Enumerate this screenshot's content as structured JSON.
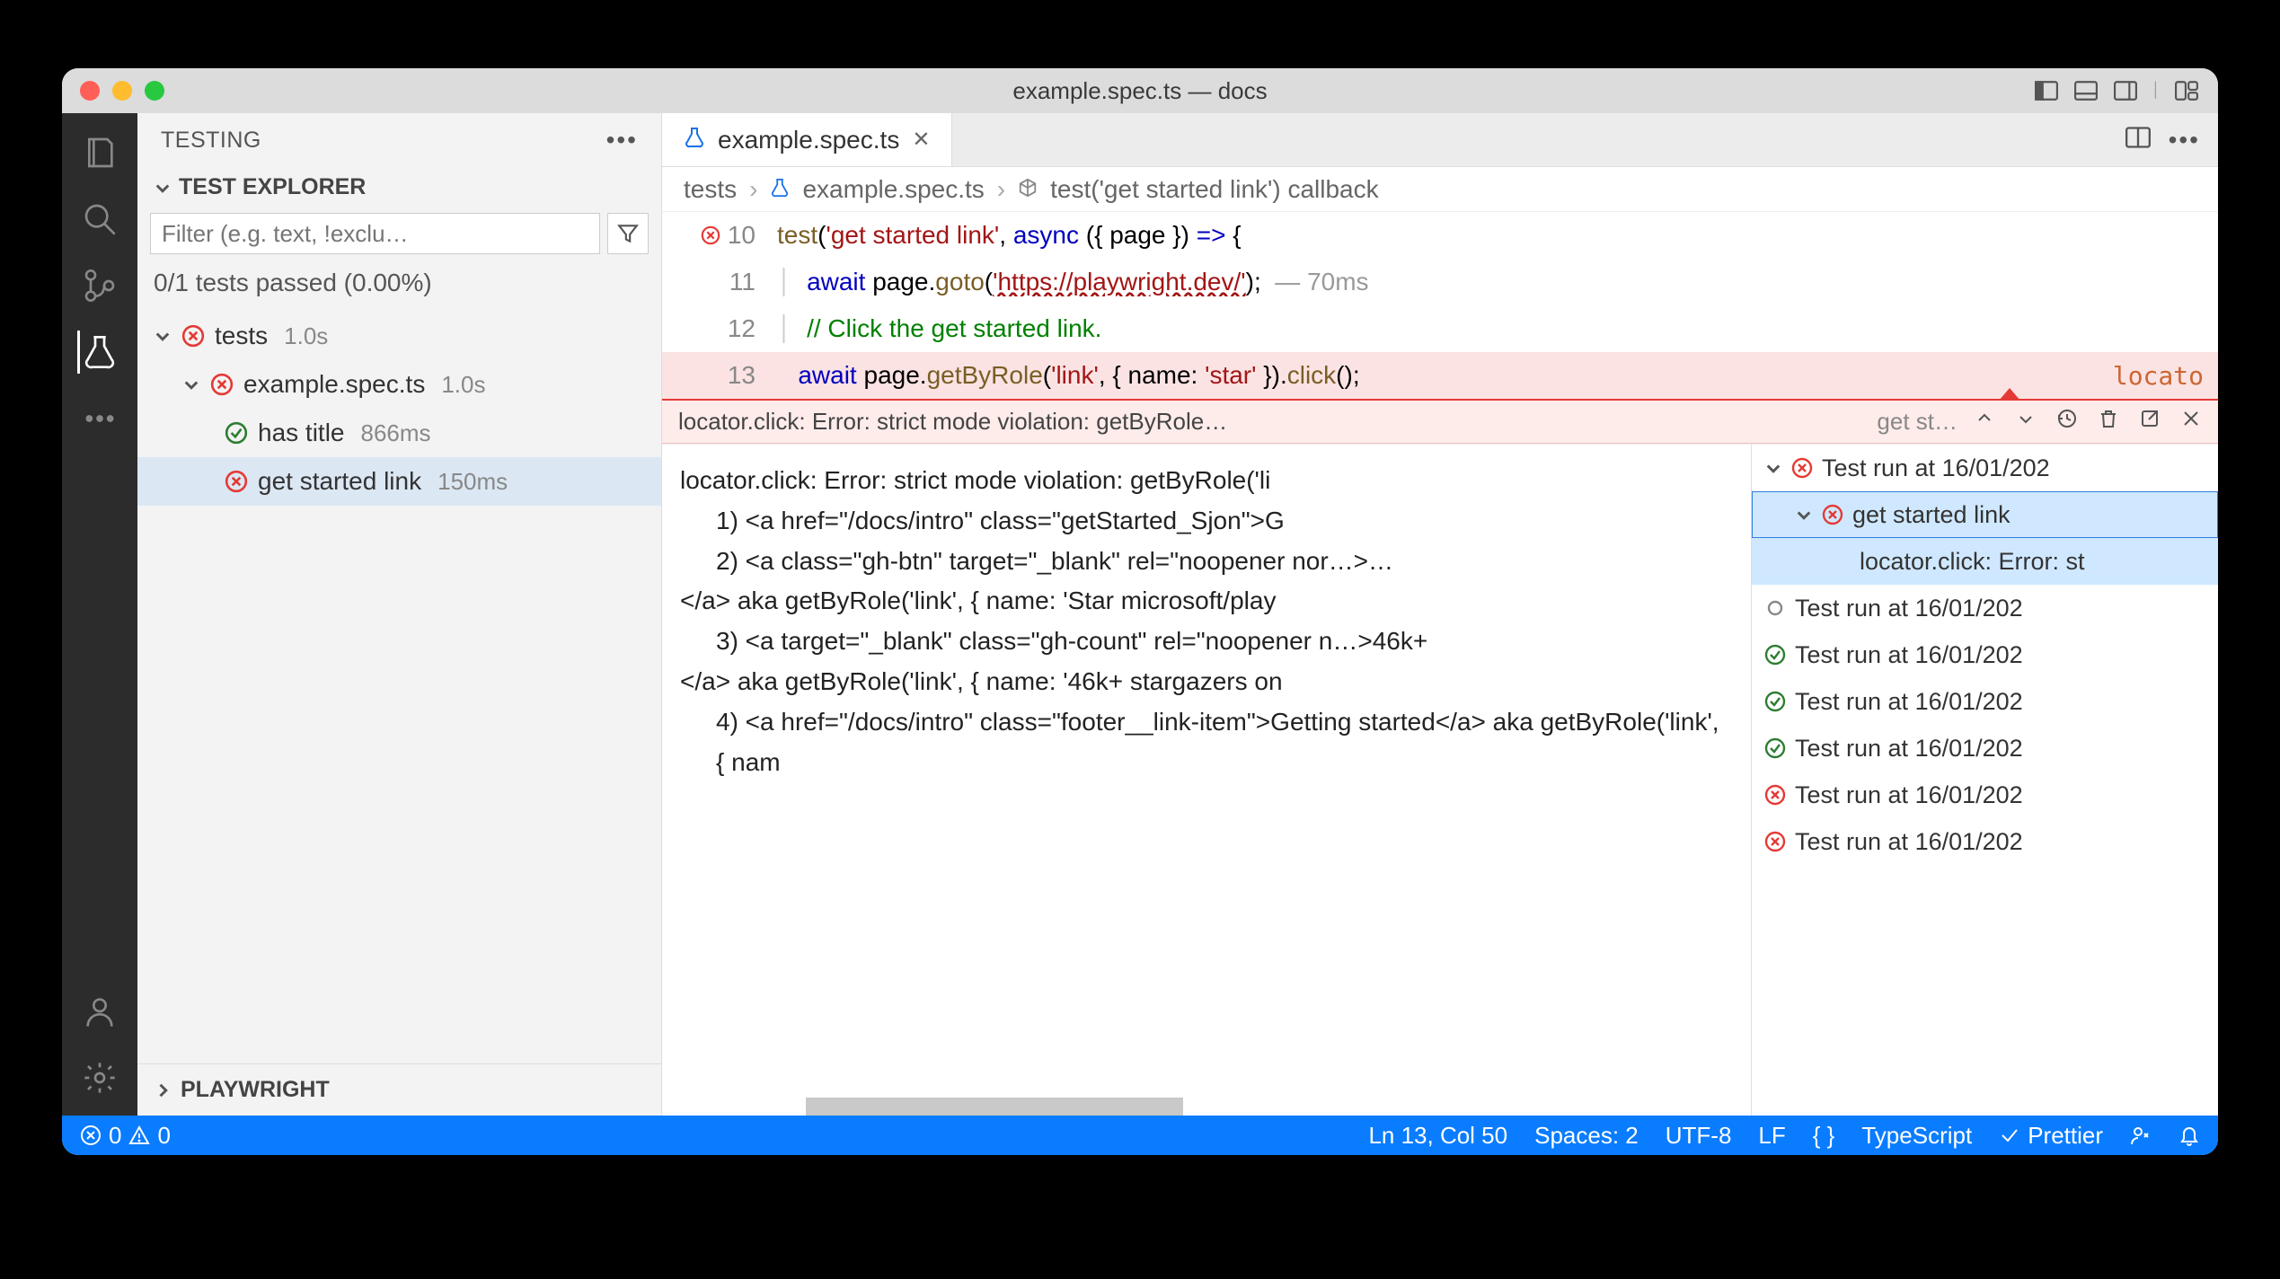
{
  "window_title": "example.spec.ts — docs",
  "sidebar": {
    "header": "TESTING",
    "section": "TEST EXPLORER",
    "filter_placeholder": "Filter (e.g. text, !exclu…",
    "stats": "0/1 tests passed (0.00%)",
    "footer": "PLAYWRIGHT",
    "tree": {
      "root": {
        "label": "tests",
        "time": "1.0s",
        "status": "fail"
      },
      "file": {
        "label": "example.spec.ts",
        "time": "1.0s",
        "status": "fail"
      },
      "tests": [
        {
          "label": "has title",
          "time": "866ms",
          "status": "pass"
        },
        {
          "label": "get started link",
          "time": "150ms",
          "status": "fail",
          "selected": true
        }
      ]
    }
  },
  "tab": {
    "label": "example.spec.ts"
  },
  "breadcrumb": {
    "seg1": "tests",
    "seg2": "example.spec.ts",
    "seg3": "test('get started link') callback"
  },
  "code": {
    "lines": [
      {
        "n": 10,
        "err": true,
        "html": "<span class='fn'>test</span>(<span class='str'>'get started link'</span>, <span class='kw'>async</span> ({ page }) <span class='kw'>=&gt;</span> {"
      },
      {
        "n": 11,
        "html": "<span class='guide'>│  </span><span class='kw'>await</span> page.<span class='fn'>goto</span>(<span class='url'>'https://playwright.dev/'</span>);",
        "annot": "— 70ms"
      },
      {
        "n": 12,
        "html": "<span class='guide'>│  </span><span class='cmt'>// Click the get started link.</span>"
      },
      {
        "n": 13,
        "errline": true,
        "html": "<span class='guide'>   </span><span class='kw'>await</span> page.<span class='fn'>getByRole</span>(<span class='str'>'link'</span>, { name: <span class='str'>'star'</span> }).<span class='fn'>click</span>();",
        "right": "locato"
      }
    ]
  },
  "error_bar": {
    "msg": "locator.click: Error: strict mode violation: getByRole…",
    "chip": "get st…"
  },
  "error_detail": {
    "l1": "locator.click: Error: strict mode violation: getByRole('li",
    "l2": "1) <a href=\"/docs/intro\" class=\"getStarted_Sjon\">G",
    "l3": "2) <a class=\"gh-btn\" target=\"_blank\" rel=\"noopener nor…>…",
    "l4": "</a> aka getByRole('link', { name: 'Star microsoft/play",
    "l5": "3) <a target=\"_blank\" class=\"gh-count\" rel=\"noopener n…>46k+",
    "l6": "</a> aka getByRole('link', { name: '46k+ stargazers on",
    "l7": "4) <a href=\"/docs/intro\" class=\"footer__link-item\">Getting started</a> aka getByRole('link', { nam"
  },
  "run_panel": {
    "items": [
      {
        "status": "fail",
        "label": "Test run at 16/01/202",
        "chev": true
      },
      {
        "status": "fail",
        "label": "get started link",
        "chev": true,
        "selected": true,
        "indent": 1
      },
      {
        "label": "locator.click: Error: st",
        "indent": 2
      },
      {
        "status": "none",
        "label": "Test run at 16/01/202"
      },
      {
        "status": "pass",
        "label": "Test run at 16/01/202"
      },
      {
        "status": "pass",
        "label": "Test run at 16/01/202"
      },
      {
        "status": "pass",
        "label": "Test run at 16/01/202"
      },
      {
        "status": "fail",
        "label": "Test run at 16/01/202"
      },
      {
        "status": "fail",
        "label": "Test run at 16/01/202"
      }
    ]
  },
  "statusbar": {
    "errors": "0",
    "warnings": "0",
    "pos": "Ln 13, Col 50",
    "spaces": "Spaces: 2",
    "encoding": "UTF-8",
    "eol": "LF",
    "lang": "TypeScript",
    "prettier": "Prettier"
  }
}
